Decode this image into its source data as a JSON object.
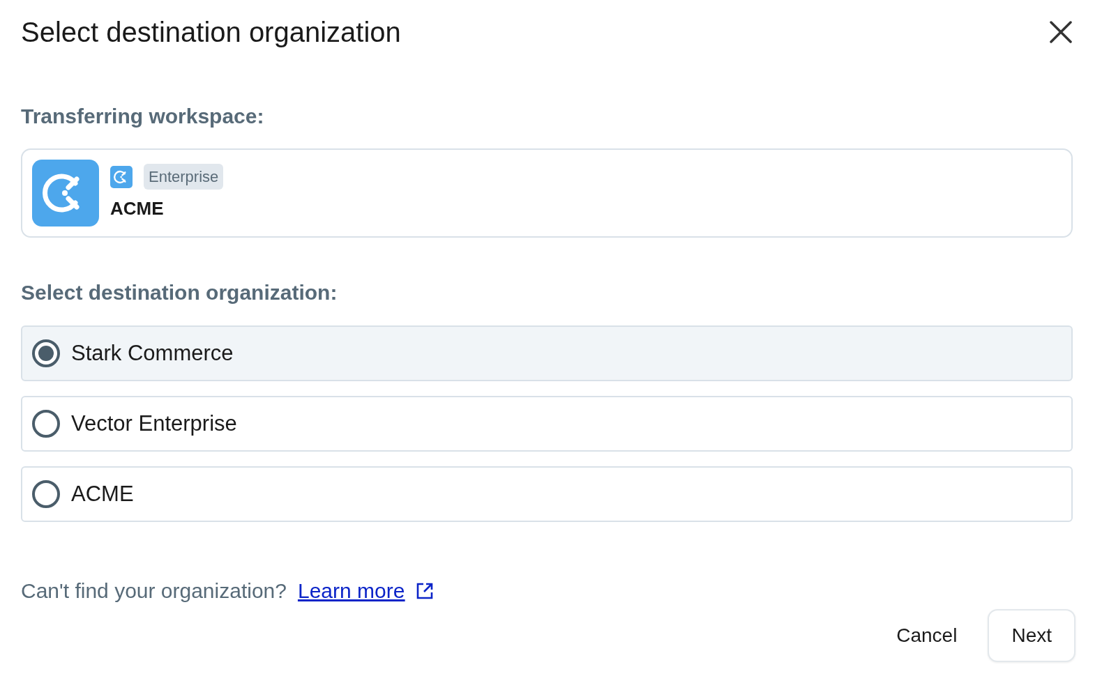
{
  "dialog": {
    "title": "Select destination organization"
  },
  "workspace": {
    "label": "Transferring workspace:",
    "badge": "Enterprise",
    "name": "ACME"
  },
  "destination": {
    "label": "Select destination organization:",
    "options": [
      {
        "name": "Stark Commerce",
        "selected": true
      },
      {
        "name": "Vector Enterprise",
        "selected": false
      },
      {
        "name": "ACME",
        "selected": false
      }
    ]
  },
  "help": {
    "text": "Can't find your organization?",
    "link": "Learn more"
  },
  "buttons": [
    {
      "label": "Cancel",
      "kind": "text"
    },
    {
      "label": "Next",
      "kind": "outline"
    }
  ]
}
